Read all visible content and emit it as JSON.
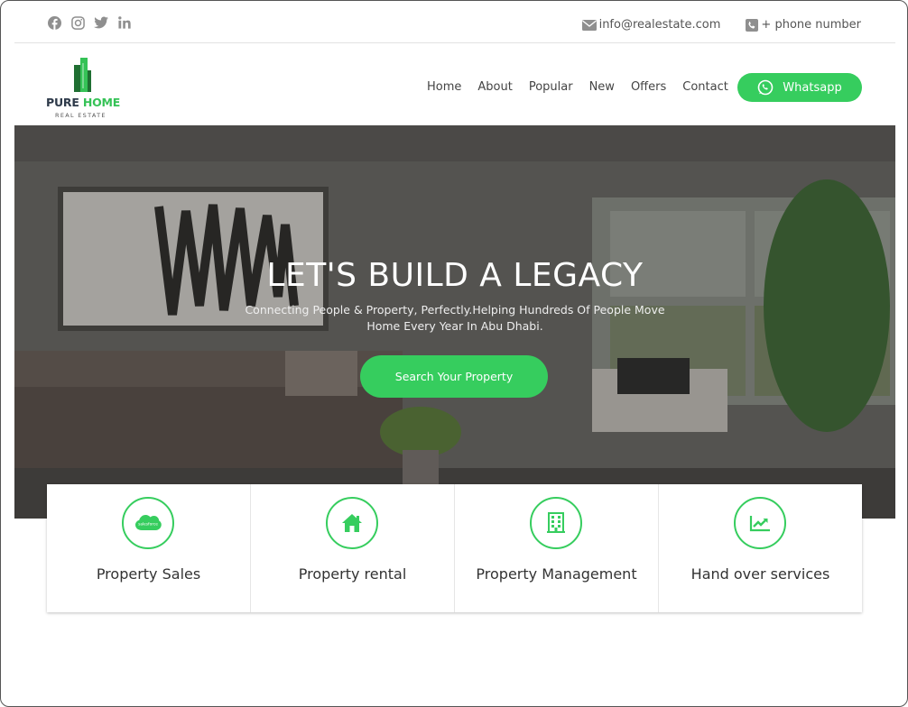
{
  "topbar": {
    "social_icons": [
      "facebook-icon",
      "instagram-icon",
      "twitter-icon",
      "linkedin-icon"
    ],
    "email": "info@realestate.com",
    "phone": "+ phone number"
  },
  "logo": {
    "brand_dark": "PURE",
    "brand_green": "HOME",
    "tagline": "REAL ESTATE"
  },
  "nav": {
    "items": [
      "Home",
      "About",
      "Popular",
      "New",
      "Offers",
      "Contact"
    ],
    "whatsapp_label": "Whatsapp"
  },
  "hero": {
    "title": "LET'S BUILD A LEGACY",
    "subtitle": "Connecting People & Property, Perfectly.Helping Hundreds Of People Move Home Every Year In Abu Dhabi.",
    "cta": "Search Your Property"
  },
  "services": [
    {
      "label": "Property Sales",
      "icon": "salesforce-icon"
    },
    {
      "label": "Property rental",
      "icon": "home-icon"
    },
    {
      "label": "Property Management",
      "icon": "building-icon"
    },
    {
      "label": "Hand over services",
      "icon": "chart-line-icon"
    }
  ],
  "colors": {
    "accent": "#36cd5e",
    "text": "#333333"
  }
}
